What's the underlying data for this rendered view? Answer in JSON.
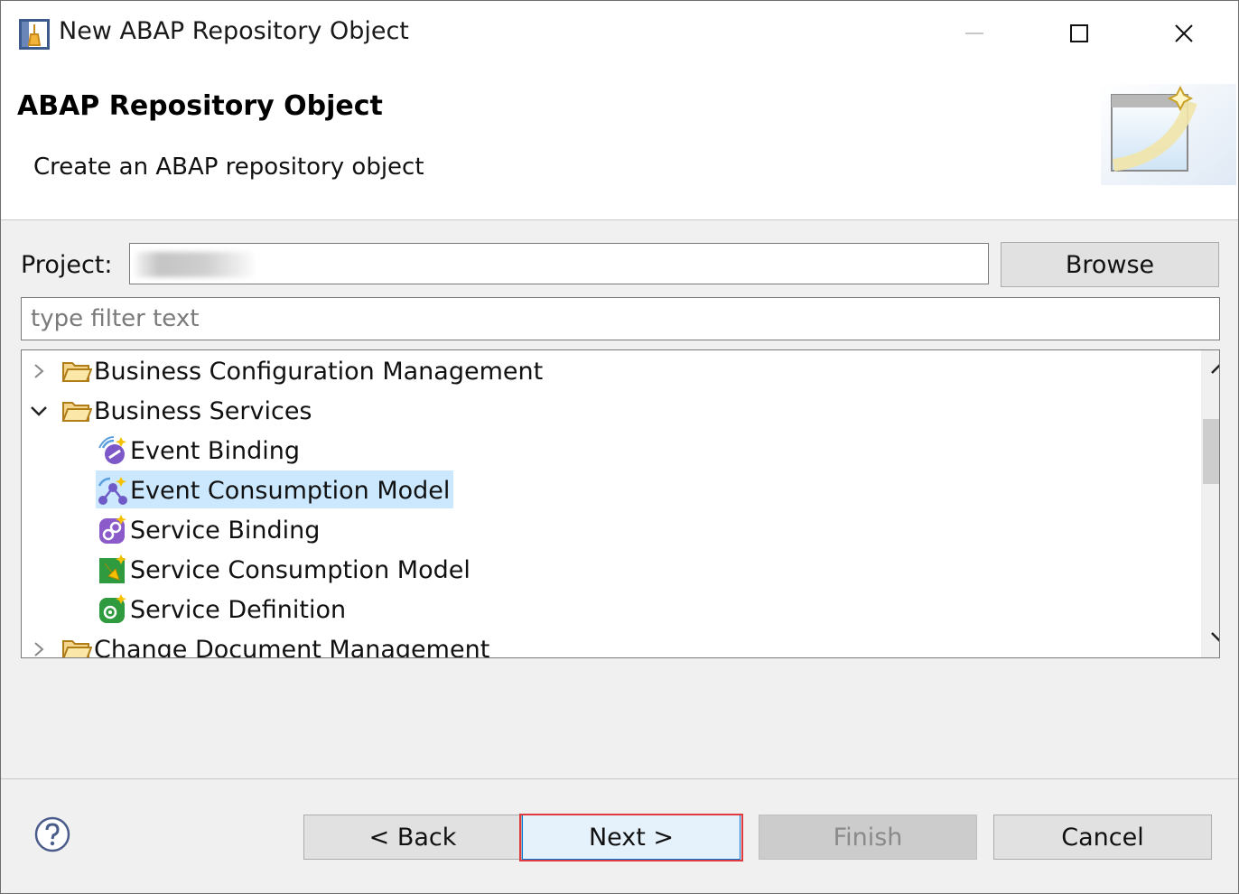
{
  "window": {
    "title": "New ABAP Repository Object",
    "app_icon": "abap-app-icon",
    "controls": [
      "minimize-icon",
      "maximize-icon",
      "close-icon"
    ]
  },
  "header": {
    "title": "ABAP Repository Object",
    "description": "Create an ABAP repository object",
    "image": "wizard-banner-image"
  },
  "project": {
    "label": "Project:",
    "value": "",
    "browse_label": "Browse"
  },
  "filter": {
    "placeholder": "type filter text",
    "value": ""
  },
  "tree": {
    "items": [
      {
        "label": "Business Configuration Management",
        "level": 0,
        "expanded": false,
        "icon": "folder-icon"
      },
      {
        "label": "Business Services",
        "level": 0,
        "expanded": true,
        "icon": "folder-icon"
      },
      {
        "label": "Event Binding",
        "level": 1,
        "icon": "event-binding-icon"
      },
      {
        "label": "Event Consumption Model",
        "level": 1,
        "icon": "event-consumption-model-icon",
        "selected": true
      },
      {
        "label": "Service Binding",
        "level": 1,
        "icon": "service-binding-icon"
      },
      {
        "label": "Service Consumption Model",
        "level": 1,
        "icon": "service-consumption-model-icon"
      },
      {
        "label": "Service Definition",
        "level": 1,
        "icon": "service-definition-icon"
      },
      {
        "label": "Change Document Management",
        "level": 0,
        "expanded": false,
        "icon": "folder-icon"
      }
    ]
  },
  "footer": {
    "help_icon": "help-icon",
    "back_label": "< Back",
    "next_label": "Next >",
    "finish_label": "Finish",
    "cancel_label": "Cancel"
  },
  "colors": {
    "selection": "#cce8ff",
    "highlight_border": "#e0393e",
    "default_button_border": "#0078d7"
  }
}
